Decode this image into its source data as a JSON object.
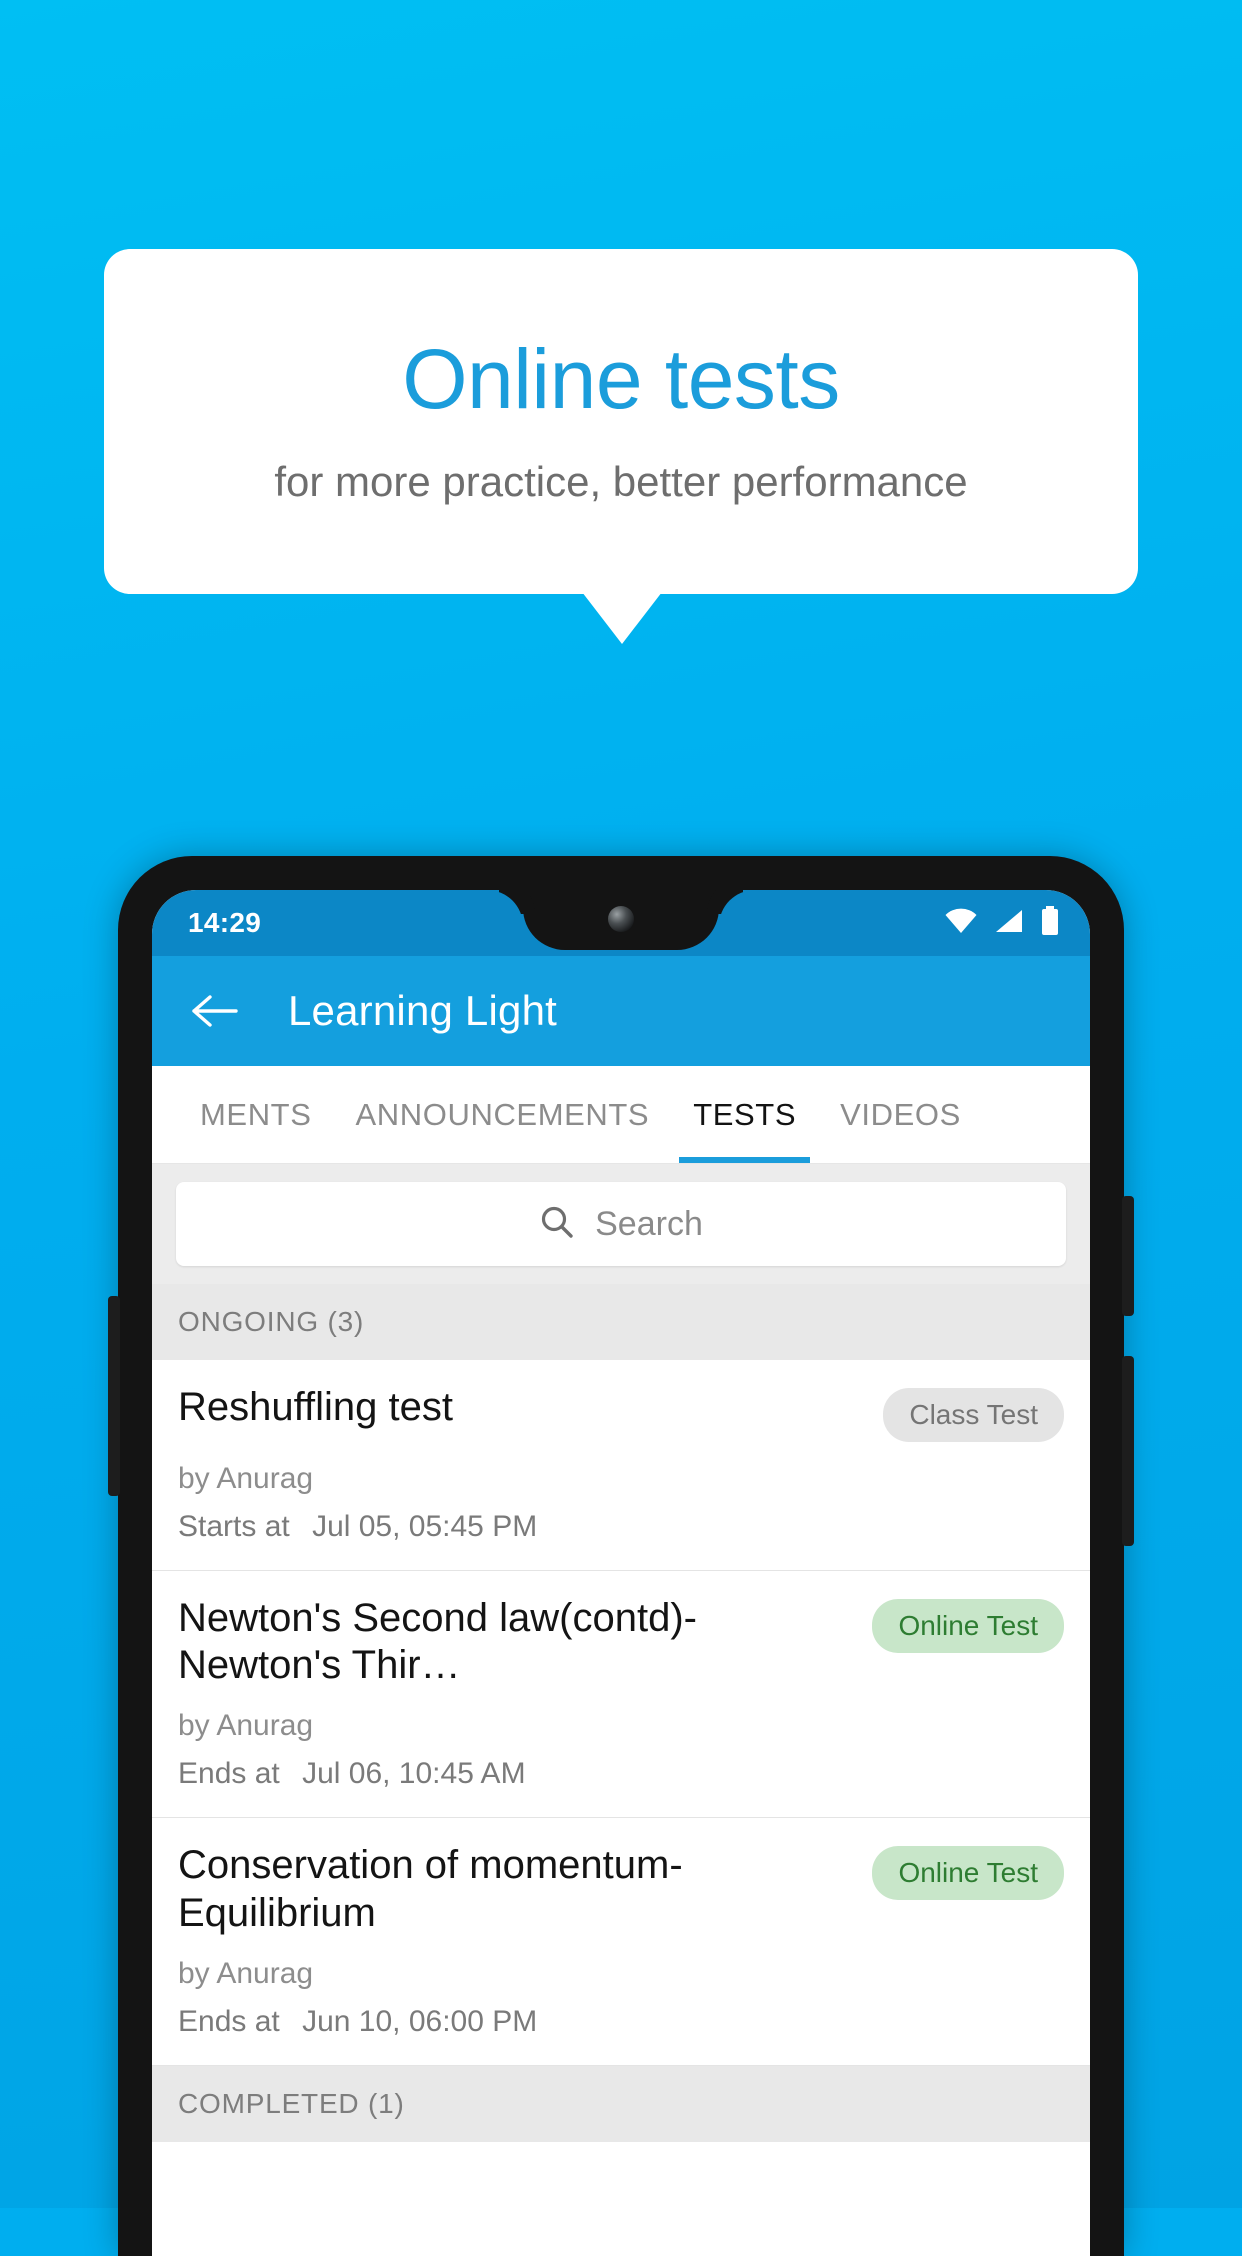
{
  "promo": {
    "title": "Online tests",
    "subtitle": "for more practice, better performance",
    "accent_color": "#1B9DDB",
    "background_color": "#00AEEF"
  },
  "phone": {
    "status_bar": {
      "time": "14:29",
      "icons": [
        "wifi-icon",
        "signal-icon",
        "battery-icon"
      ]
    },
    "app_bar": {
      "back_icon": "back-arrow-icon",
      "title": "Learning Light"
    },
    "tabs": [
      {
        "label": "MENTS",
        "active": false
      },
      {
        "label": "ANNOUNCEMENTS",
        "active": false
      },
      {
        "label": "TESTS",
        "active": true
      },
      {
        "label": "VIDEOS",
        "active": false
      }
    ],
    "search": {
      "icon": "search-icon",
      "placeholder": "Search",
      "value": ""
    },
    "sections": [
      {
        "header": "ONGOING (3)",
        "tests": [
          {
            "title": "Reshuffling test",
            "badge": "Class Test",
            "badge_style": "grey",
            "author": "by Anurag",
            "when_label": "Starts at",
            "when_value": "Jul 05, 05:45 PM"
          },
          {
            "title": "Newton's Second law(contd)-Newton's Thir…",
            "badge": "Online Test",
            "badge_style": "green",
            "author": "by Anurag",
            "when_label": "Ends at",
            "when_value": "Jul 06, 10:45 AM"
          },
          {
            "title": "Conservation of momentum-Equilibrium",
            "badge": "Online Test",
            "badge_style": "green",
            "author": "by Anurag",
            "when_label": "Ends at",
            "when_value": "Jun 10, 06:00 PM"
          }
        ]
      },
      {
        "header": "COMPLETED (1)",
        "tests": []
      }
    ]
  }
}
